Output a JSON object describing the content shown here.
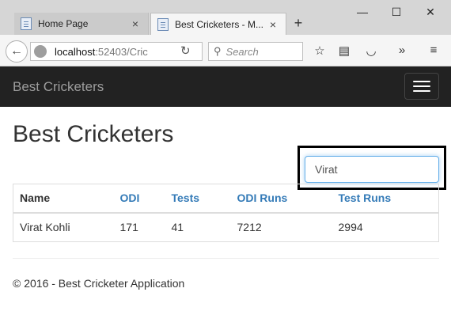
{
  "browser": {
    "tabs": [
      {
        "title": "Home Page",
        "close": "×"
      },
      {
        "title": "Best Cricketers - M...",
        "close": "×"
      }
    ],
    "new_tab": "+",
    "window": {
      "minimize": "—",
      "maximize": "☐",
      "close": "✕"
    },
    "address": {
      "host": "localhost",
      "path": ":52403/Cric"
    },
    "search_placeholder": "Search",
    "icons": [
      "back-icon",
      "globe-icon",
      "reload-icon",
      "search-icon",
      "bookmark-star-icon",
      "reader-list-icon",
      "pocket-icon",
      "overflow-icon",
      "menu-icon"
    ]
  },
  "navbar": {
    "brand": "Best Cricketers"
  },
  "page": {
    "title": "Best Cricketers"
  },
  "search": {
    "value": "Virat"
  },
  "table": {
    "headers": [
      "Name",
      "ODI",
      "Tests",
      "ODI Runs",
      "Test Runs"
    ],
    "rows": [
      [
        "Virat Kohli",
        "171",
        "41",
        "7212",
        "2994"
      ]
    ]
  },
  "footer": {
    "text": "© 2016 - Best Cricketer Application"
  },
  "colors": {
    "navbar": "#222222",
    "link": "#337ab7",
    "focus": "#66afe9"
  }
}
